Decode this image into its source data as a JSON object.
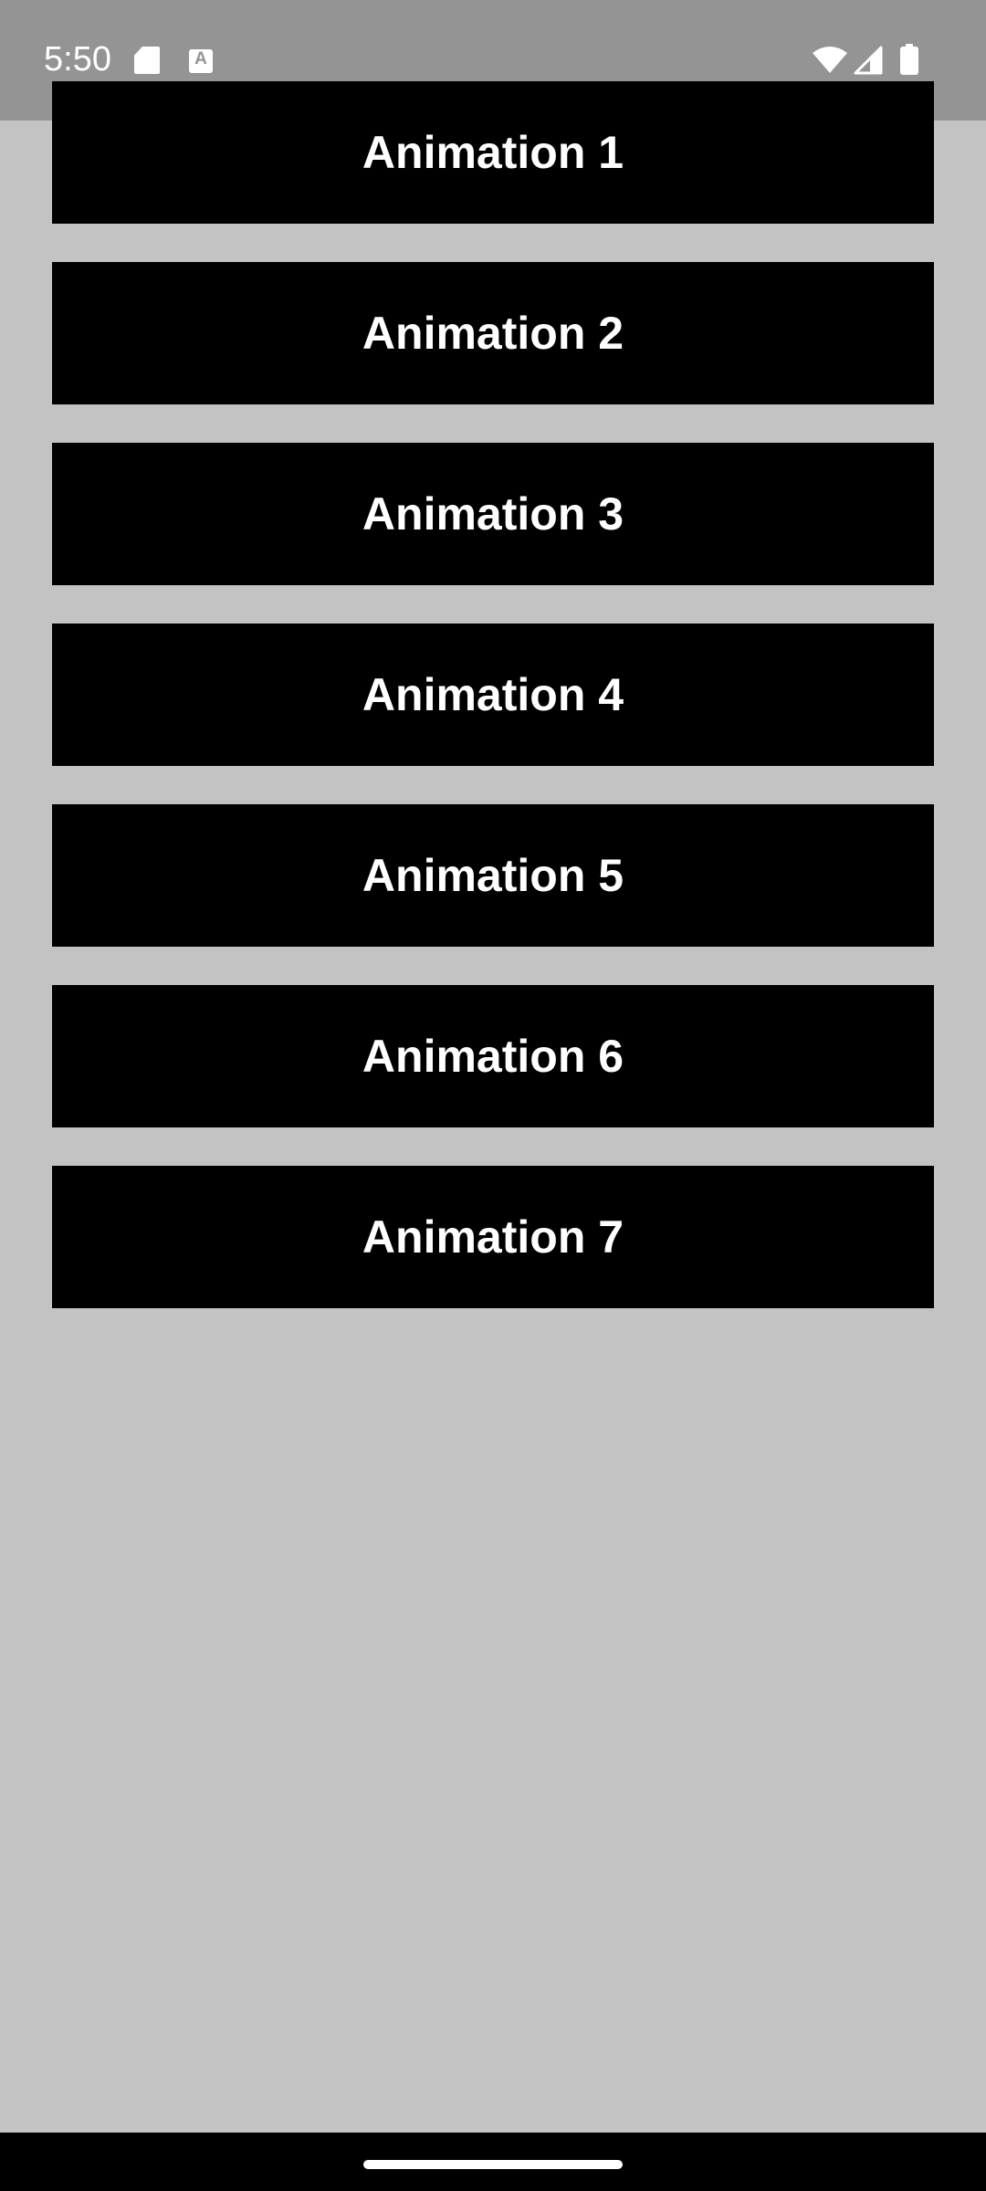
{
  "status_bar": {
    "time": "5:50",
    "a_icon_letter": "A",
    "icons": [
      "sd-card-icon",
      "text-a-icon",
      "wifi-icon",
      "cell-signal-icon",
      "battery-icon"
    ]
  },
  "buttons": [
    {
      "label": "Animation 1"
    },
    {
      "label": "Animation 2"
    },
    {
      "label": "Animation 3"
    },
    {
      "label": "Animation 4"
    },
    {
      "label": "Animation 5"
    },
    {
      "label": "Animation 6"
    },
    {
      "label": "Animation 7"
    }
  ],
  "colors": {
    "background": "#c3c3c3",
    "status_bar": "#949494",
    "button_bg": "#000000",
    "button_text": "#ffffff",
    "nav_bar": "#000000"
  }
}
